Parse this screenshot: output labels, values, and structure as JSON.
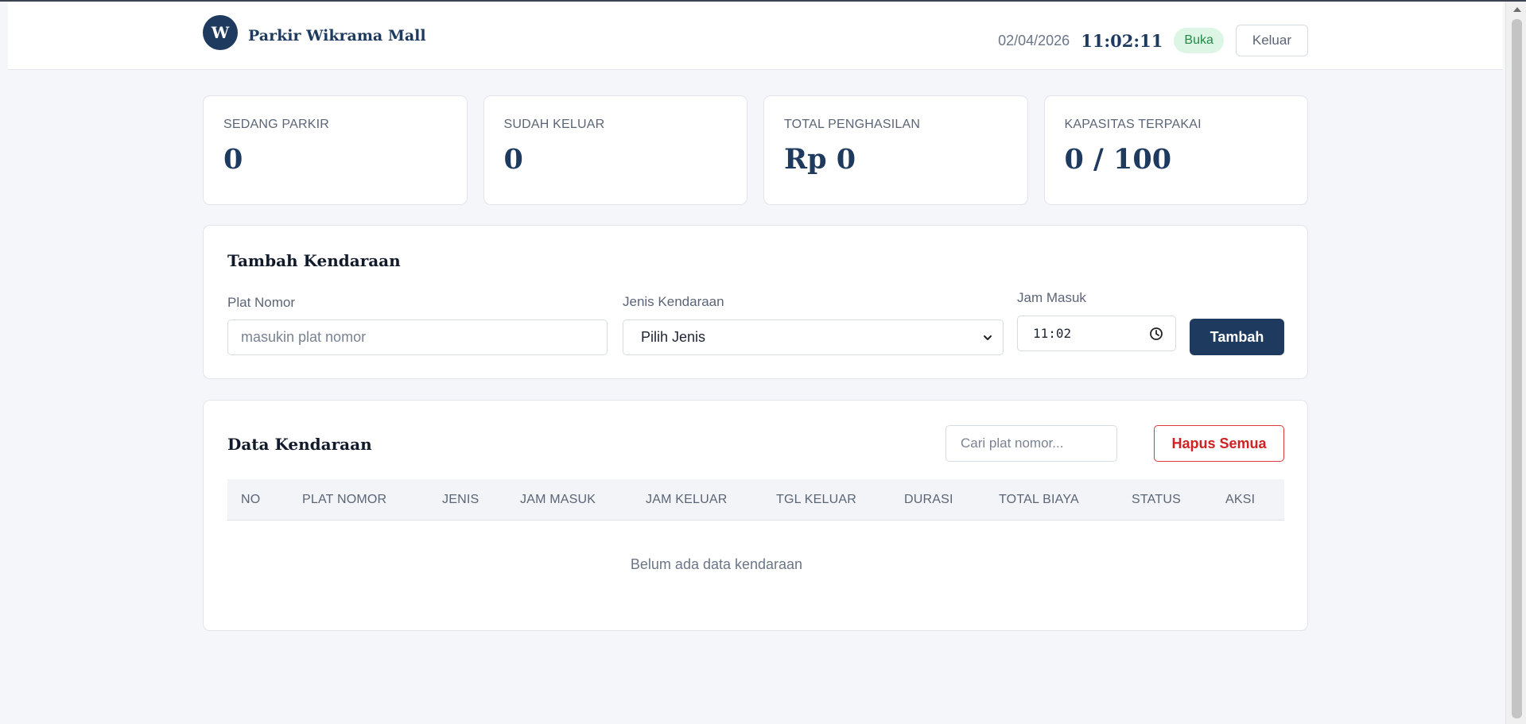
{
  "header": {
    "logo_letter": "W",
    "app_title": "Parkir Wikrama Mall",
    "date": "02/04/2026",
    "time": "11:02:11",
    "status": "Buka",
    "logout_label": "Keluar"
  },
  "stats": [
    {
      "label": "SEDANG PARKIR",
      "value": "0"
    },
    {
      "label": "SUDAH KELUAR",
      "value": "0"
    },
    {
      "label": "TOTAL PENGHASILAN",
      "value": "Rp 0"
    },
    {
      "label": "KAPASITAS TERPAKAI",
      "value": "0 / 100"
    }
  ],
  "add_form": {
    "title": "Tambah Kendaraan",
    "plate_label": "Plat Nomor",
    "plate_placeholder": "masukin plat nomor",
    "type_label": "Jenis Kendaraan",
    "type_selected": "Pilih Jenis",
    "time_label": "Jam Masuk",
    "time_value": "11:02",
    "submit_label": "Tambah"
  },
  "data_table": {
    "title": "Data Kendaraan",
    "search_placeholder": "Cari plat nomor...",
    "clear_label": "Hapus Semua",
    "columns": [
      "NO",
      "PLAT NOMOR",
      "JENIS",
      "JAM MASUK",
      "JAM KELUAR",
      "TGL KELUAR",
      "DURASI",
      "TOTAL BIAYA",
      "STATUS",
      "AKSI"
    ],
    "empty_message": "Belum ada data kendaraan"
  },
  "colors": {
    "primary": "#1e3a5f",
    "danger": "#cf2222",
    "success_bg": "#dcf5e4",
    "success_text": "#1d8a44",
    "page_bg": "#f4f6f9"
  }
}
